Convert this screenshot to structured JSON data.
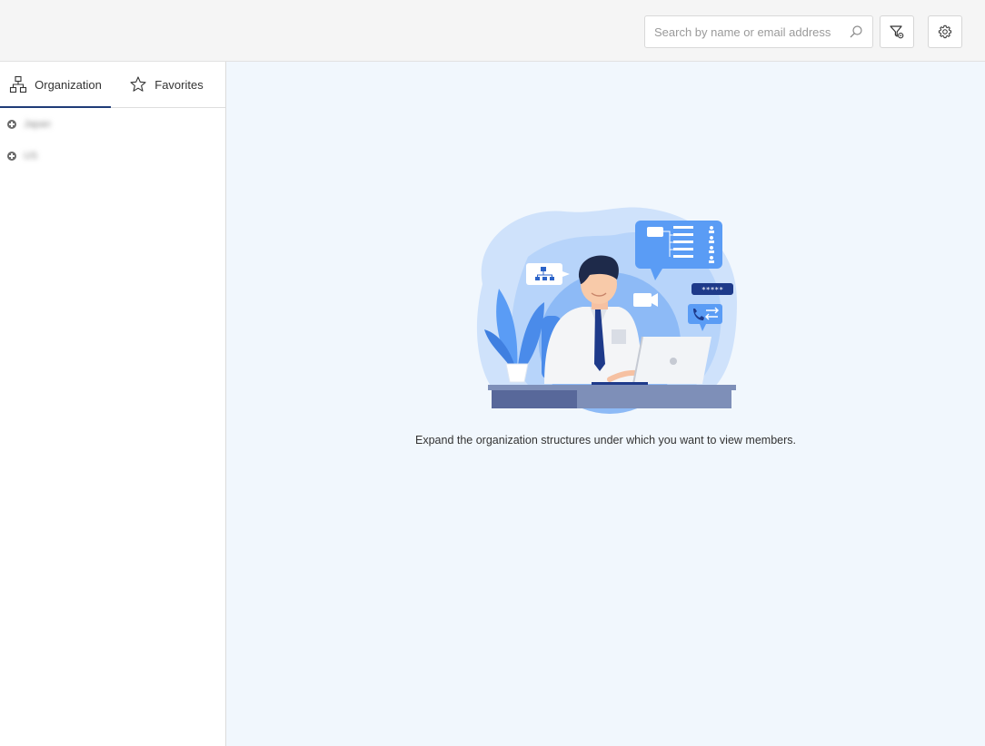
{
  "header": {
    "search": {
      "placeholder": "Search by name or email address",
      "value": ""
    },
    "icons": {
      "search": "search-icon",
      "filter": "filter-icon",
      "settings": "gear-icon"
    }
  },
  "sidebar": {
    "tabs": [
      {
        "label": "Organization",
        "icon": "org-chart-icon",
        "active": true
      },
      {
        "label": "Favorites",
        "icon": "star-icon",
        "active": false
      }
    ],
    "tree": [
      {
        "label": "Japan"
      },
      {
        "label": "US"
      }
    ]
  },
  "main": {
    "hint": "Expand the organization structures under which you want to view members.",
    "illustration": {
      "bubble_text": "*****"
    }
  },
  "colors": {
    "accent": "#1f3c78",
    "main_background": "#f1f7fd",
    "topbar_background": "#f5f5f5",
    "illustration_blue": "#5a9cf5"
  }
}
